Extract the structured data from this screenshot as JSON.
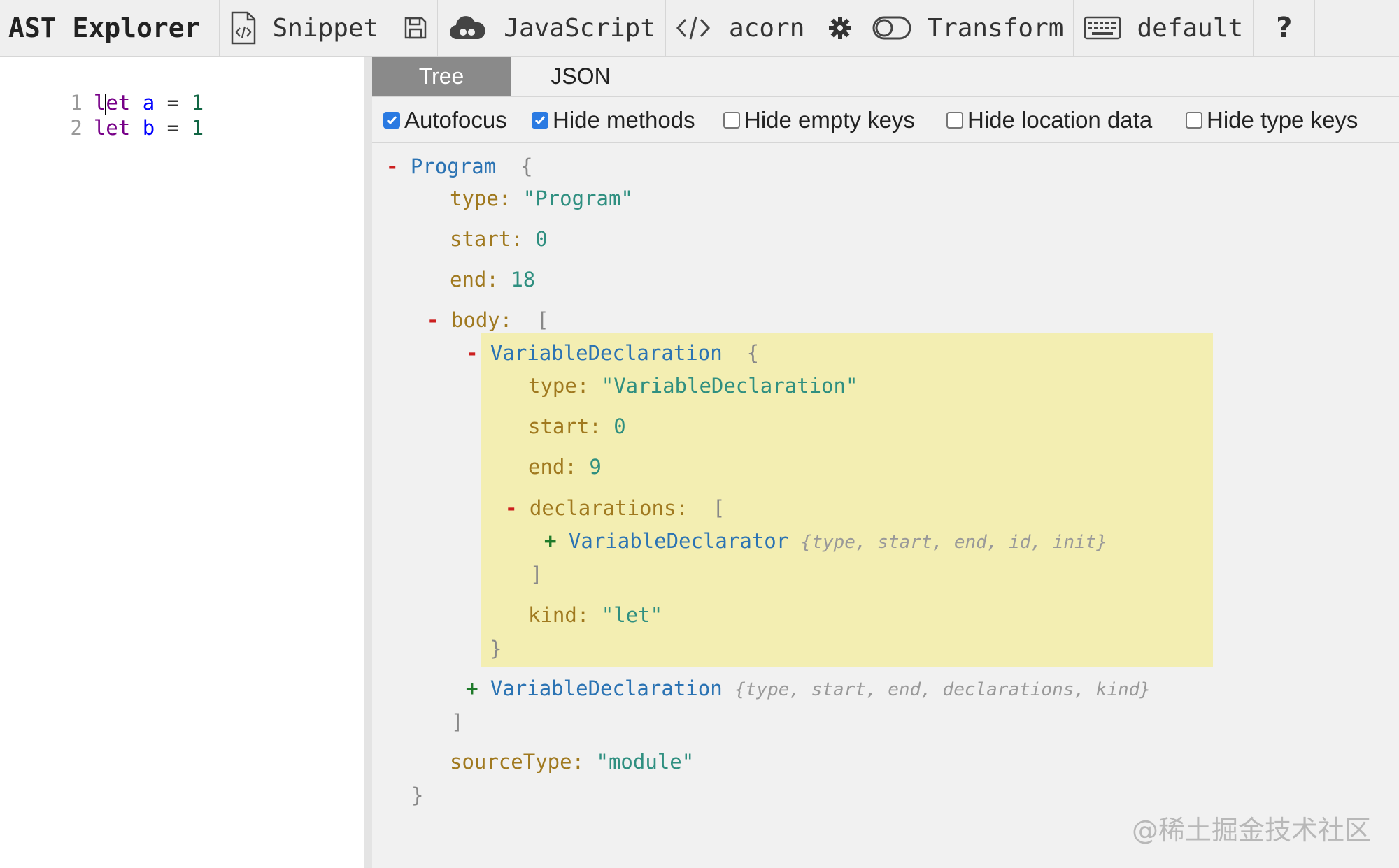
{
  "toolbar": {
    "title": "AST Explorer",
    "snippet_label": "Snippet",
    "language_label": "JavaScript",
    "parser_label": "acorn",
    "transform_label": "Transform",
    "keymap_label": "default",
    "help_label": "?"
  },
  "editor": {
    "lines": [
      {
        "num": "1",
        "kw": "let",
        "var": "a",
        "op": "=",
        "val": "1"
      },
      {
        "num": "2",
        "kw": "let",
        "var": "b",
        "op": "=",
        "val": "1"
      }
    ]
  },
  "output": {
    "tabs": [
      {
        "label": "Tree",
        "active": true
      },
      {
        "label": "JSON",
        "active": false
      }
    ],
    "options": [
      {
        "label": "Autofocus",
        "checked": true
      },
      {
        "label": "Hide methods",
        "checked": true
      },
      {
        "label": "Hide empty keys",
        "checked": false
      },
      {
        "label": "Hide location data",
        "checked": false
      },
      {
        "label": "Hide type keys",
        "checked": false
      }
    ]
  },
  "tree": {
    "program_name": "Program",
    "program_type": "\"Program\"",
    "program_start": "0",
    "program_end": "18",
    "body_key": "body:",
    "decl1_name": "VariableDeclaration",
    "decl1_type": "\"VariableDeclaration\"",
    "decl1_start": "0",
    "decl1_end": "9",
    "declarations_key": "declarations:",
    "declarator_name": "VariableDeclarator",
    "declarator_summary": "{type, start, end, id, init}",
    "decl1_kind": "\"let\"",
    "decl2_name": "VariableDeclaration",
    "decl2_summary": "{type, start, end, declarations, kind}",
    "source_type": "\"module\""
  },
  "watermark": "@稀土掘金技术社区",
  "colors": {
    "highlight": "#f3eeb2",
    "active_tab": "#8a8a8a",
    "checkbox": "#2a7ae2"
  }
}
